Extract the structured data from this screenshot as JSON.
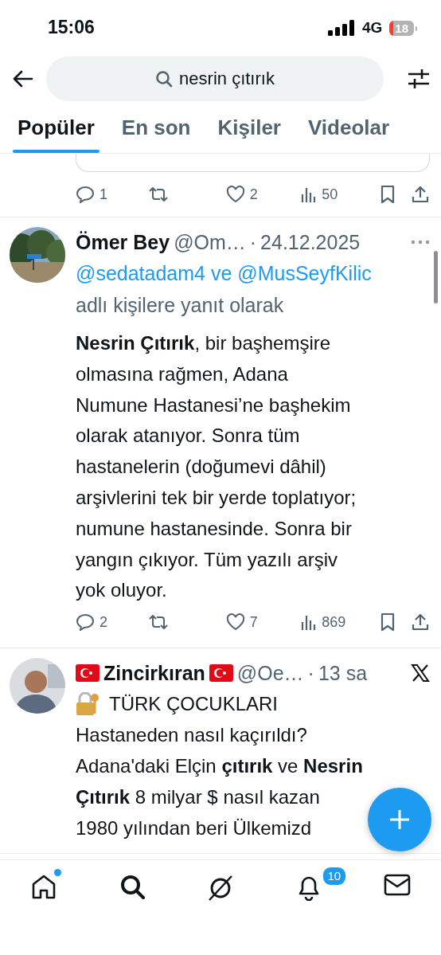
{
  "status_bar": {
    "time": "15:06",
    "network": "4G",
    "battery": "18"
  },
  "search": {
    "value": "nesrin çıtırık"
  },
  "tabs": [
    {
      "label": "Popüler",
      "selected": true
    },
    {
      "label": "En son",
      "selected": false
    },
    {
      "label": "Kişiler",
      "selected": false
    },
    {
      "label": "Videolar",
      "selected": false
    }
  ],
  "previous_post": {
    "actions": [
      {
        "kind": "reply",
        "count": "1"
      },
      {
        "kind": "repost"
      },
      {
        "kind": "like",
        "count": "2"
      },
      {
        "kind": "views",
        "count": "50"
      },
      {
        "kind": "bookmark"
      },
      {
        "kind": "share"
      }
    ]
  },
  "posts": [
    {
      "name": "Ömer Bey",
      "flags": false,
      "handle": "@Om…",
      "separator": "·",
      "time": "24.12.2025",
      "more_menu": true,
      "reply_users": "@sedatadam4 ve @MusSeyfKilic",
      "reply_suffix": "adlı kişilere yanıt olarak",
      "body": [
        "**Nesrin Çıtırık**, bir başhemşire",
        "olmasına rağmen, Adana",
        "Numune Hastanesi’ne başhekim",
        "olarak atanıyor. Sonra tüm",
        "hastanelerin (doğumevi dâhil)",
        "arşivlerini tek bir yerde toplatıyor;",
        "numune hastanesinde. Sonra bir",
        "yangın çıkıyor. Tüm yazılı arşiv",
        "yok oluyor."
      ],
      "actions": [
        {
          "kind": "reply",
          "count": "2"
        },
        {
          "kind": "repost"
        },
        {
          "kind": "like",
          "count": "7"
        },
        {
          "kind": "views",
          "count": "869"
        },
        {
          "kind": "bookmark"
        },
        {
          "kind": "share"
        }
      ]
    },
    {
      "name": "Zincirkıran",
      "flags": true,
      "handle": "@Oe…",
      "separator": "·",
      "time": "13 sa",
      "x_logo": true,
      "headline_lock": true,
      "headline": "TÜRK ÇOCUKLARI",
      "body": [
        "Hastaneden nasıl kaçırıldı?",
        "Adana'daki Elçin **çıtırık** ve **Nesrin**",
        "**Çıtırık** 8 milyar $ nasıl kazan",
        "1980 yılından beri Ülkemizd"
      ]
    }
  ],
  "bottom_nav": [
    {
      "kind": "home",
      "selected": false,
      "dot": true
    },
    {
      "kind": "search",
      "selected": true
    },
    {
      "kind": "grok",
      "selected": false
    },
    {
      "kind": "notifications",
      "selected": false,
      "badge": "10"
    },
    {
      "kind": "messages",
      "selected": false
    }
  ]
}
